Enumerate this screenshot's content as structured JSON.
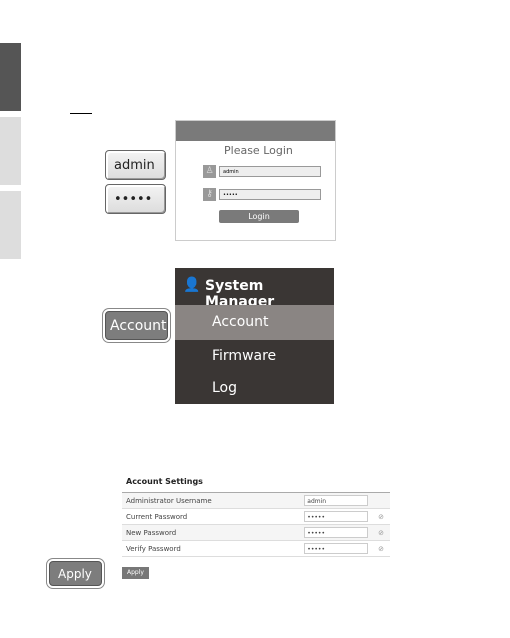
{
  "login": {
    "title": "Please Login",
    "username": "admin",
    "password": "•••••",
    "button": "Login",
    "callout_user": "admin",
    "callout_pass": "•••••"
  },
  "system_manager": {
    "title": "System Manager",
    "items": [
      "Account",
      "Firmware",
      "Log"
    ],
    "callout": "Account"
  },
  "account_settings": {
    "title": "Account Settings",
    "rows": [
      {
        "label": "Administrator Username",
        "value": "admin",
        "eye": false
      },
      {
        "label": "Current Password",
        "value": "•••••",
        "eye": true
      },
      {
        "label": "New Password",
        "value": "•••••",
        "eye": true
      },
      {
        "label": "Verify Password",
        "value": "•••••",
        "eye": true
      }
    ],
    "apply": "Apply",
    "callout": "Apply"
  }
}
